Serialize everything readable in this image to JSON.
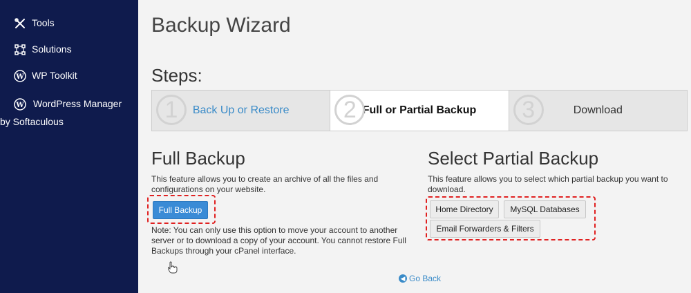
{
  "sidebar": {
    "items": [
      {
        "label": "Tools",
        "icon": "tools-icon"
      },
      {
        "label": "Solutions",
        "icon": "solutions-icon"
      },
      {
        "label": "WP Toolkit",
        "icon": "wordpress-icon"
      },
      {
        "label": "WordPress Manager",
        "label2": "by Softaculous",
        "icon": "wordpress-icon"
      }
    ]
  },
  "page": {
    "title": "Backup Wizard",
    "steps_title": "Steps:"
  },
  "steps": [
    {
      "num": "1",
      "label": "Back Up or Restore"
    },
    {
      "num": "2",
      "label": "Full or Partial Backup"
    },
    {
      "num": "3",
      "label": "Download"
    }
  ],
  "full_backup": {
    "title": "Full Backup",
    "description": "This feature allows you to create an archive of all the files and configurations on your website.",
    "button": "Full Backup",
    "note": "Note: You can only use this option to move your account to another server or to download a copy of your account. You cannot restore Full Backups through your cPanel interface."
  },
  "partial_backup": {
    "title": "Select Partial Backup",
    "description": "This feature allows you to select which partial backup you want to download.",
    "buttons": [
      "Home Directory",
      "MySQL Databases",
      "Email Forwarders & Filters"
    ]
  },
  "go_back": "Go Back",
  "colors": {
    "sidebar_bg": "#0f1b4d",
    "accent": "#3a8bd6",
    "highlight": "#e02020"
  }
}
